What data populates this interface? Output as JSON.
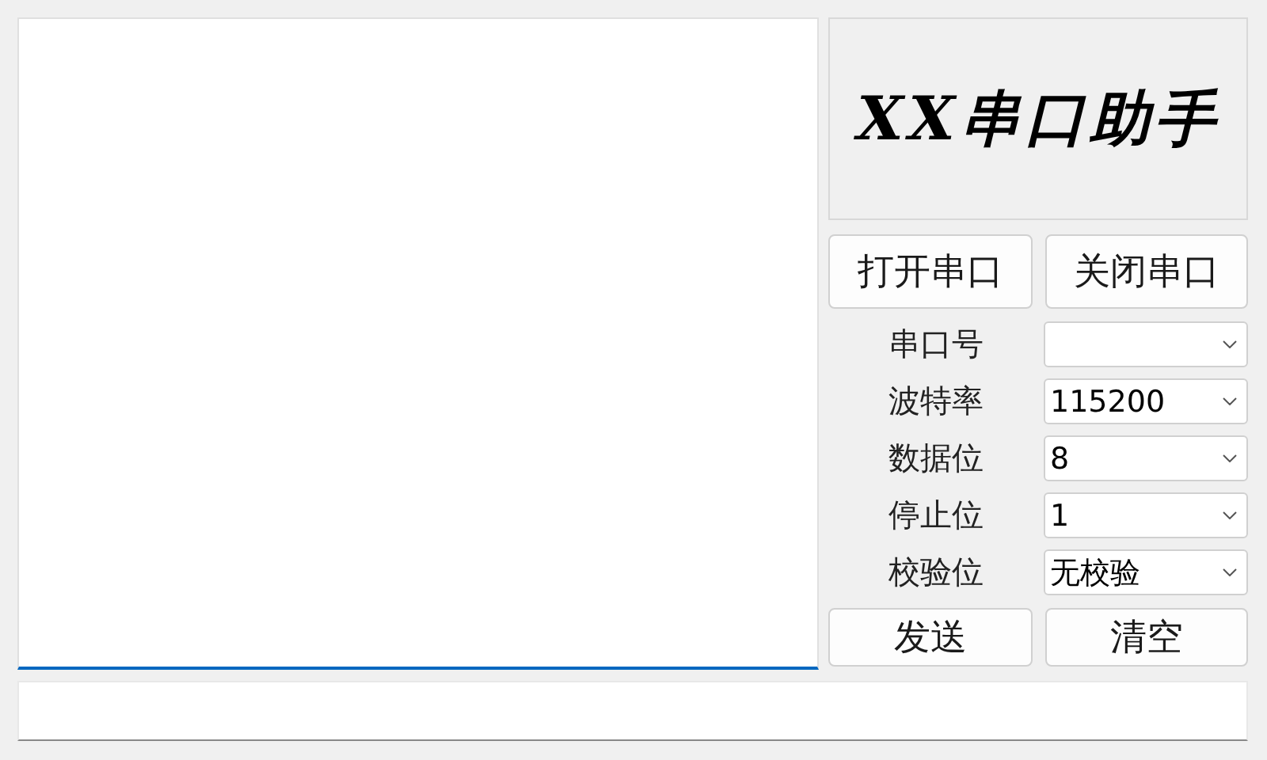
{
  "receive_area": {
    "focused": true
  },
  "logo": {
    "text": "XX串口助手"
  },
  "port_buttons": [
    "打开串口",
    "关闭串口"
  ],
  "settings": [
    {
      "label": "串口号"
    },
    {
      "label": "波特率",
      "value": "115200"
    },
    {
      "label": "数据位",
      "value": "8"
    },
    {
      "label": "停止位",
      "value": "1"
    },
    {
      "label": "校验位",
      "value": "无校验"
    }
  ],
  "action_buttons": [
    "发送",
    "清空"
  ],
  "send_field": {
    "focused": false
  }
}
